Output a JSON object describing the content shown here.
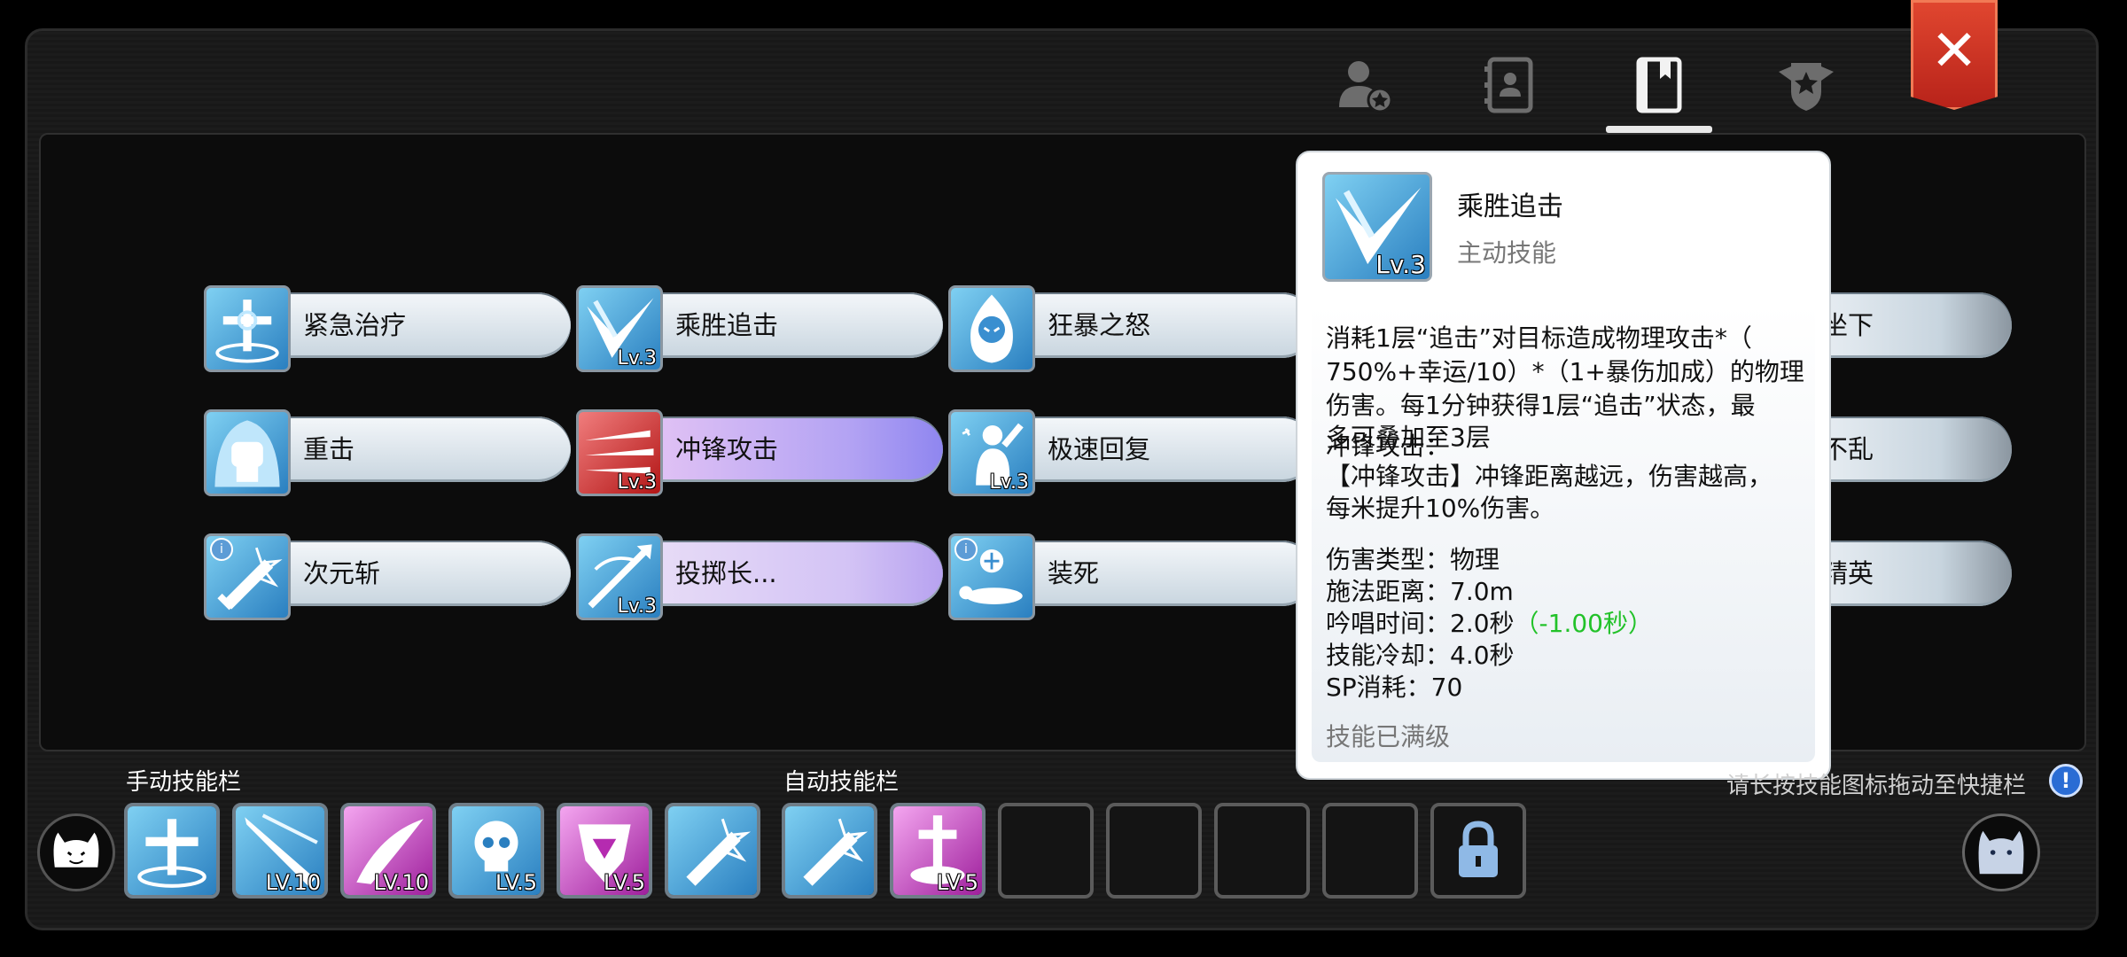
{
  "header": {
    "tabs": [
      {
        "icon": "character-star-icon"
      },
      {
        "icon": "contact-book-icon"
      },
      {
        "icon": "skill-book-icon",
        "active": true
      },
      {
        "icon": "guild-emblem-icon"
      }
    ],
    "close_label": "✕"
  },
  "skills": [
    {
      "name": "紧急治疗",
      "icon": "healing-cross-icon",
      "level": "",
      "style": "normal",
      "info": false
    },
    {
      "name": "乘胜追击",
      "icon": "pursuit-v-icon",
      "level": "Lv.3",
      "style": "normal",
      "info": false
    },
    {
      "name": "狂暴之怒",
      "icon": "rage-flame-icon",
      "level": "",
      "style": "normal",
      "info": false
    },
    {
      "name": "重击",
      "icon": "fist-icon",
      "level": "",
      "style": "normal",
      "info": false
    },
    {
      "name": "冲锋攻击",
      "icon": "charge-blades-icon",
      "level": "Lv.3",
      "style": "purple",
      "info": false
    },
    {
      "name": "极速回复",
      "icon": "quick-recover-icon",
      "level": "Lv.3",
      "style": "normal",
      "info": false
    },
    {
      "name": "次元斩",
      "icon": "dimension-slash-icon",
      "level": "",
      "style": "normal",
      "info": true
    },
    {
      "name": "投掷长...",
      "icon": "spear-throw-icon",
      "level": "Lv.3",
      "style": "lpurple",
      "info": false
    },
    {
      "name": "装死",
      "icon": "play-dead-icon",
      "level": "",
      "style": "normal",
      "info": true
    }
  ],
  "partial_skills": [
    "坐下",
    "不乱",
    "精英"
  ],
  "tooltip": {
    "skill_name": "乘胜追击",
    "skill_type": "主动技能",
    "level": "Lv.3",
    "desc_lines": [
      "消耗1层“追击”对目标造成物理攻击*（",
      "750%+幸运/10）*（1+暴伤加成）的物理",
      "伤害。每1分钟获得1层“追击”状态，最",
      "多可叠加至3层"
    ],
    "overlap_line": "冲锋攻击：",
    "extra_lines": [
      "【冲锋攻击】冲锋距离越远，伤害越高，",
      "每米提升10%伤害。"
    ],
    "stats": [
      {
        "label": "伤害类型：",
        "value": "物理",
        "bonus": ""
      },
      {
        "label": "施法距离：",
        "value": "7.0m",
        "bonus": ""
      },
      {
        "label": "吟唱时间：",
        "value": "2.0秒",
        "bonus": "（-1.00秒）"
      },
      {
        "label": "技能冷却：",
        "value": "4.0秒",
        "bonus": ""
      },
      {
        "label": "SP消耗：",
        "value": "70",
        "bonus": ""
      }
    ],
    "footer": "技能已满级"
  },
  "bottom": {
    "manual_label": "手动技能栏",
    "auto_label": "自动技能栏",
    "hint": "请长按技能图标拖动至快捷栏",
    "hint_icon": "!",
    "manual_slots": [
      {
        "icon": "healing-cross-icon",
        "level": "",
        "color": "blue"
      },
      {
        "icon": "light-strike-icon",
        "level": "LV.10",
        "color": "blue"
      },
      {
        "icon": "pink-slash-icon",
        "level": "LV.10",
        "color": "pink"
      },
      {
        "icon": "skull-chain-icon",
        "level": "LV.5",
        "color": "blue"
      },
      {
        "icon": "pink-armor-icon",
        "level": "LV.5",
        "color": "pink"
      },
      {
        "icon": "sword-burst-icon",
        "level": "",
        "color": "blue"
      }
    ],
    "auto_slots": [
      {
        "icon": "sword-burst-icon",
        "level": "",
        "color": "blue"
      },
      {
        "icon": "holy-cross-icon",
        "level": "LV.5",
        "color": "pink"
      }
    ],
    "empty_slots": 4,
    "locked_icon": "lock-icon"
  },
  "colors": {
    "accent_green": "#22c229",
    "close_red": "#d2352a"
  }
}
